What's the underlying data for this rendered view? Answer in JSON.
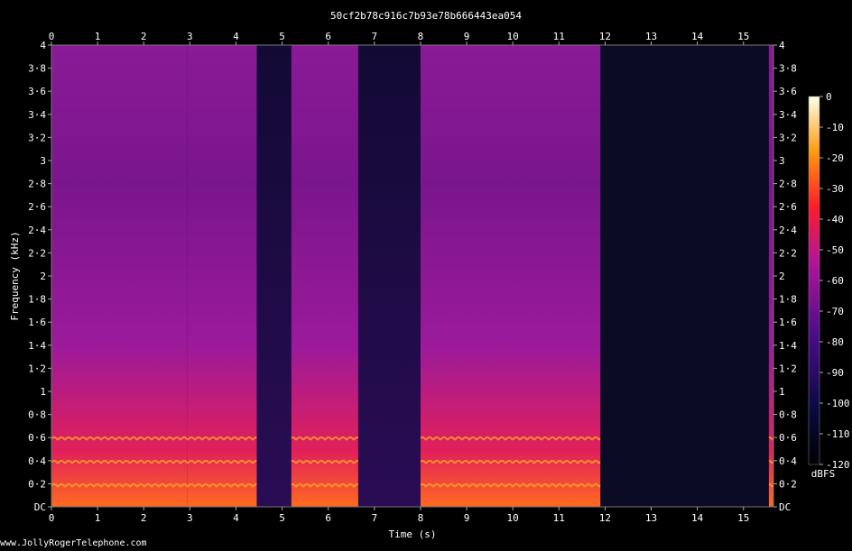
{
  "chart_data": {
    "type": "heatmap",
    "title": "50cf2b78c916c7b93e78b666443ea054",
    "xlabel": "Time (s)",
    "ylabel": "Frequency (kHz)",
    "xlim": [
      0,
      15.65
    ],
    "ylim": [
      0,
      4
    ],
    "x_ticks": [
      "0",
      "1",
      "2",
      "3",
      "4",
      "5",
      "6",
      "7",
      "8",
      "9",
      "10",
      "11",
      "12",
      "13",
      "14",
      "15"
    ],
    "y_ticks": [
      "DC",
      "0·2",
      "0·4",
      "0·6",
      "0·8",
      "1",
      "1·2",
      "1·4",
      "1·6",
      "1·8",
      "2",
      "2·2",
      "2·4",
      "2·6",
      "2·8",
      "3",
      "3·2",
      "3·4",
      "3·6",
      "3·8",
      "4"
    ],
    "colorbar": {
      "label": "dBFS",
      "range": [
        -120,
        0
      ],
      "ticks": [
        "0",
        "-10",
        "-20",
        "-30",
        "-40",
        "-50",
        "-60",
        "-70",
        "-80",
        "-90",
        "-100",
        "-110",
        "-120"
      ]
    },
    "activity_segments_s": [
      {
        "start": 0.0,
        "end": 2.95,
        "level": "speech"
      },
      {
        "start": 2.95,
        "end": 4.45,
        "level": "speech"
      },
      {
        "start": 4.45,
        "end": 5.2,
        "level": "quiet"
      },
      {
        "start": 5.2,
        "end": 6.65,
        "level": "speech"
      },
      {
        "start": 6.65,
        "end": 8.0,
        "level": "quiet"
      },
      {
        "start": 8.0,
        "end": 11.9,
        "level": "speech"
      },
      {
        "start": 11.9,
        "end": 15.55,
        "level": "silence"
      },
      {
        "start": 15.55,
        "end": 15.65,
        "level": "speech"
      }
    ]
  },
  "footer": {
    "credit": "www.JollyRogerTelephone.com"
  },
  "colors": {
    "background": "#000000",
    "low": "#0a0a2a",
    "mid": "#8a1aa0",
    "high": "#ff2a1a",
    "peak": "#ffffc8"
  }
}
